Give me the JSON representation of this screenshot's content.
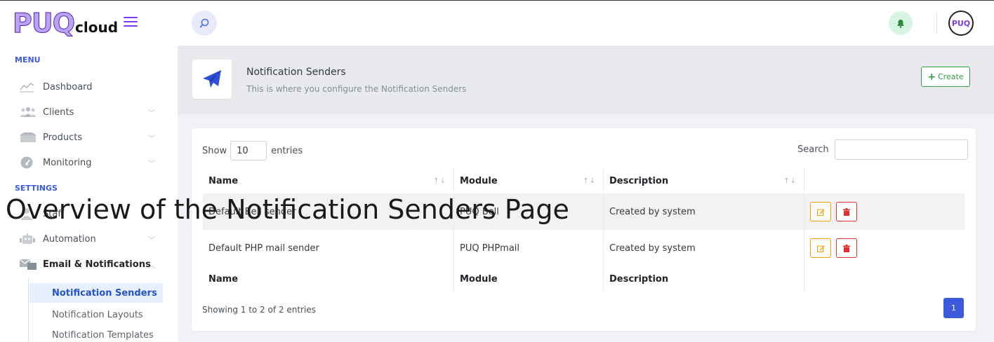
{
  "brand": {
    "logo_big": "PUQ",
    "logo_small": "cloud"
  },
  "header": {
    "avatar_text": "PUQ"
  },
  "sidebar": {
    "menu_title": "MENU",
    "settings_title": "SETTINGS",
    "items": [
      {
        "label": "Dashboard",
        "icon": "chart-line-icon"
      },
      {
        "label": "Clients",
        "icon": "users-icon"
      },
      {
        "label": "Products",
        "icon": "boxes-icon"
      },
      {
        "label": "Monitoring",
        "icon": "gauge-icon"
      },
      {
        "label": "Staff",
        "icon": "staff-icon"
      },
      {
        "label": "Automation",
        "icon": "robot-icon"
      },
      {
        "label": "Email & Notifications",
        "icon": "mail-bell-icon"
      }
    ],
    "sub_items": [
      {
        "label": "Notification Senders"
      },
      {
        "label": "Notification Layouts"
      },
      {
        "label": "Notification Templates"
      }
    ]
  },
  "page": {
    "title": "Notification Senders",
    "subtitle": "This is where you configure the Notification Senders",
    "create_label": "Create"
  },
  "table": {
    "show_label": "Show",
    "entries_label": "entries",
    "page_length": "10",
    "search_label": "Search",
    "columns": [
      "Name",
      "Module",
      "Description"
    ],
    "sort_glyph": "↑↓",
    "rows": [
      {
        "name": "Default Bell sender",
        "module": "PUQ Bell",
        "description": "Created by system"
      },
      {
        "name": "Default PHP mail sender",
        "module": "PUQ PHPmail",
        "description": "Created by system"
      }
    ],
    "info": "Showing 1 to 2 of 2 entries",
    "current_page": "1"
  },
  "overlay_caption": "Overview of the Notification Senders Page",
  "colors": {
    "accent": "#3b5bdb",
    "brand": "#7c3aed",
    "success": "#2f9e44",
    "warning": "#f59f00",
    "danger": "#e03131"
  }
}
